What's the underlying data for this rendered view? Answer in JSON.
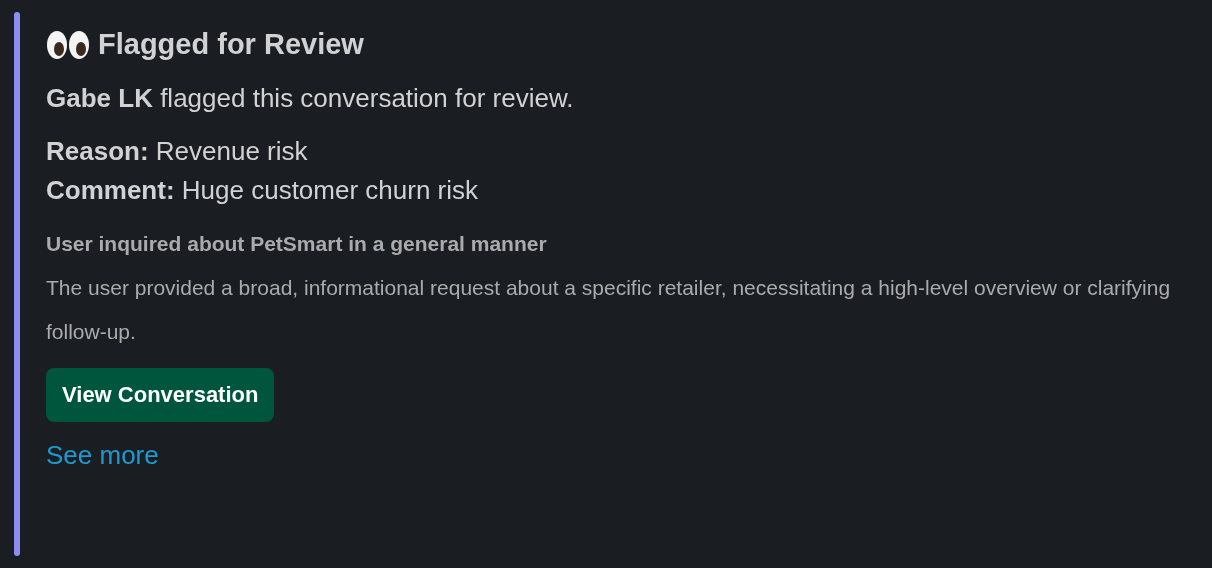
{
  "title": "Flagged for Review",
  "flag_sentence": "**Gabe LK** flagged this conversation for review.",
  "fields": [
    {
      "label": "Reason:",
      "value": "Revenue risk"
    },
    {
      "label": "Comment:",
      "value": "Huge customer churn risk"
    }
  ],
  "summary_title": "User inquired about PetSmart in a general manner",
  "summary_text": "The user provided a broad, informational request about a specific retailer, necessitating a high-level overview or clarifying follow-up.",
  "button": "View Conversation",
  "link": "See more"
}
